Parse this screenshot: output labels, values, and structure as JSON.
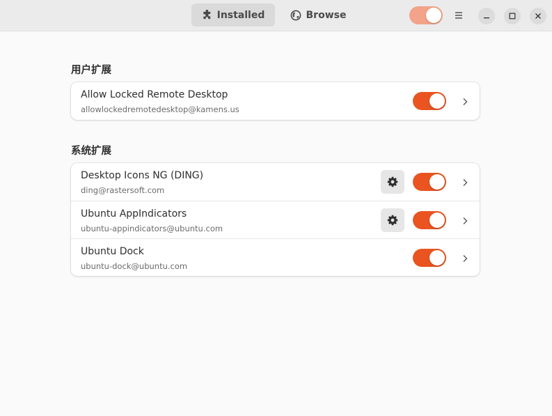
{
  "header": {
    "tabs": [
      {
        "label": "Installed",
        "icon": "puzzle-piece-icon",
        "active": true
      },
      {
        "label": "Browse",
        "icon": "globe-icon",
        "active": false
      }
    ],
    "global_toggle_on": true
  },
  "sections": {
    "user": {
      "title": "用户扩展",
      "items": [
        {
          "name": "Allow Locked Remote Desktop",
          "uuid": "allowlockedremotedesktop@kamens.us",
          "enabled": true,
          "has_settings": false
        }
      ]
    },
    "system": {
      "title": "系统扩展",
      "items": [
        {
          "name": "Desktop Icons NG (DING)",
          "uuid": "ding@rastersoft.com",
          "enabled": true,
          "has_settings": true
        },
        {
          "name": "Ubuntu AppIndicators",
          "uuid": "ubuntu-appindicators@ubuntu.com",
          "enabled": true,
          "has_settings": true
        },
        {
          "name": "Ubuntu Dock",
          "uuid": "ubuntu-dock@ubuntu.com",
          "enabled": true,
          "has_settings": false
        }
      ]
    }
  },
  "colors": {
    "accent": "#e95420",
    "accent_dim": "#f2a389",
    "background": "#fafafa"
  }
}
